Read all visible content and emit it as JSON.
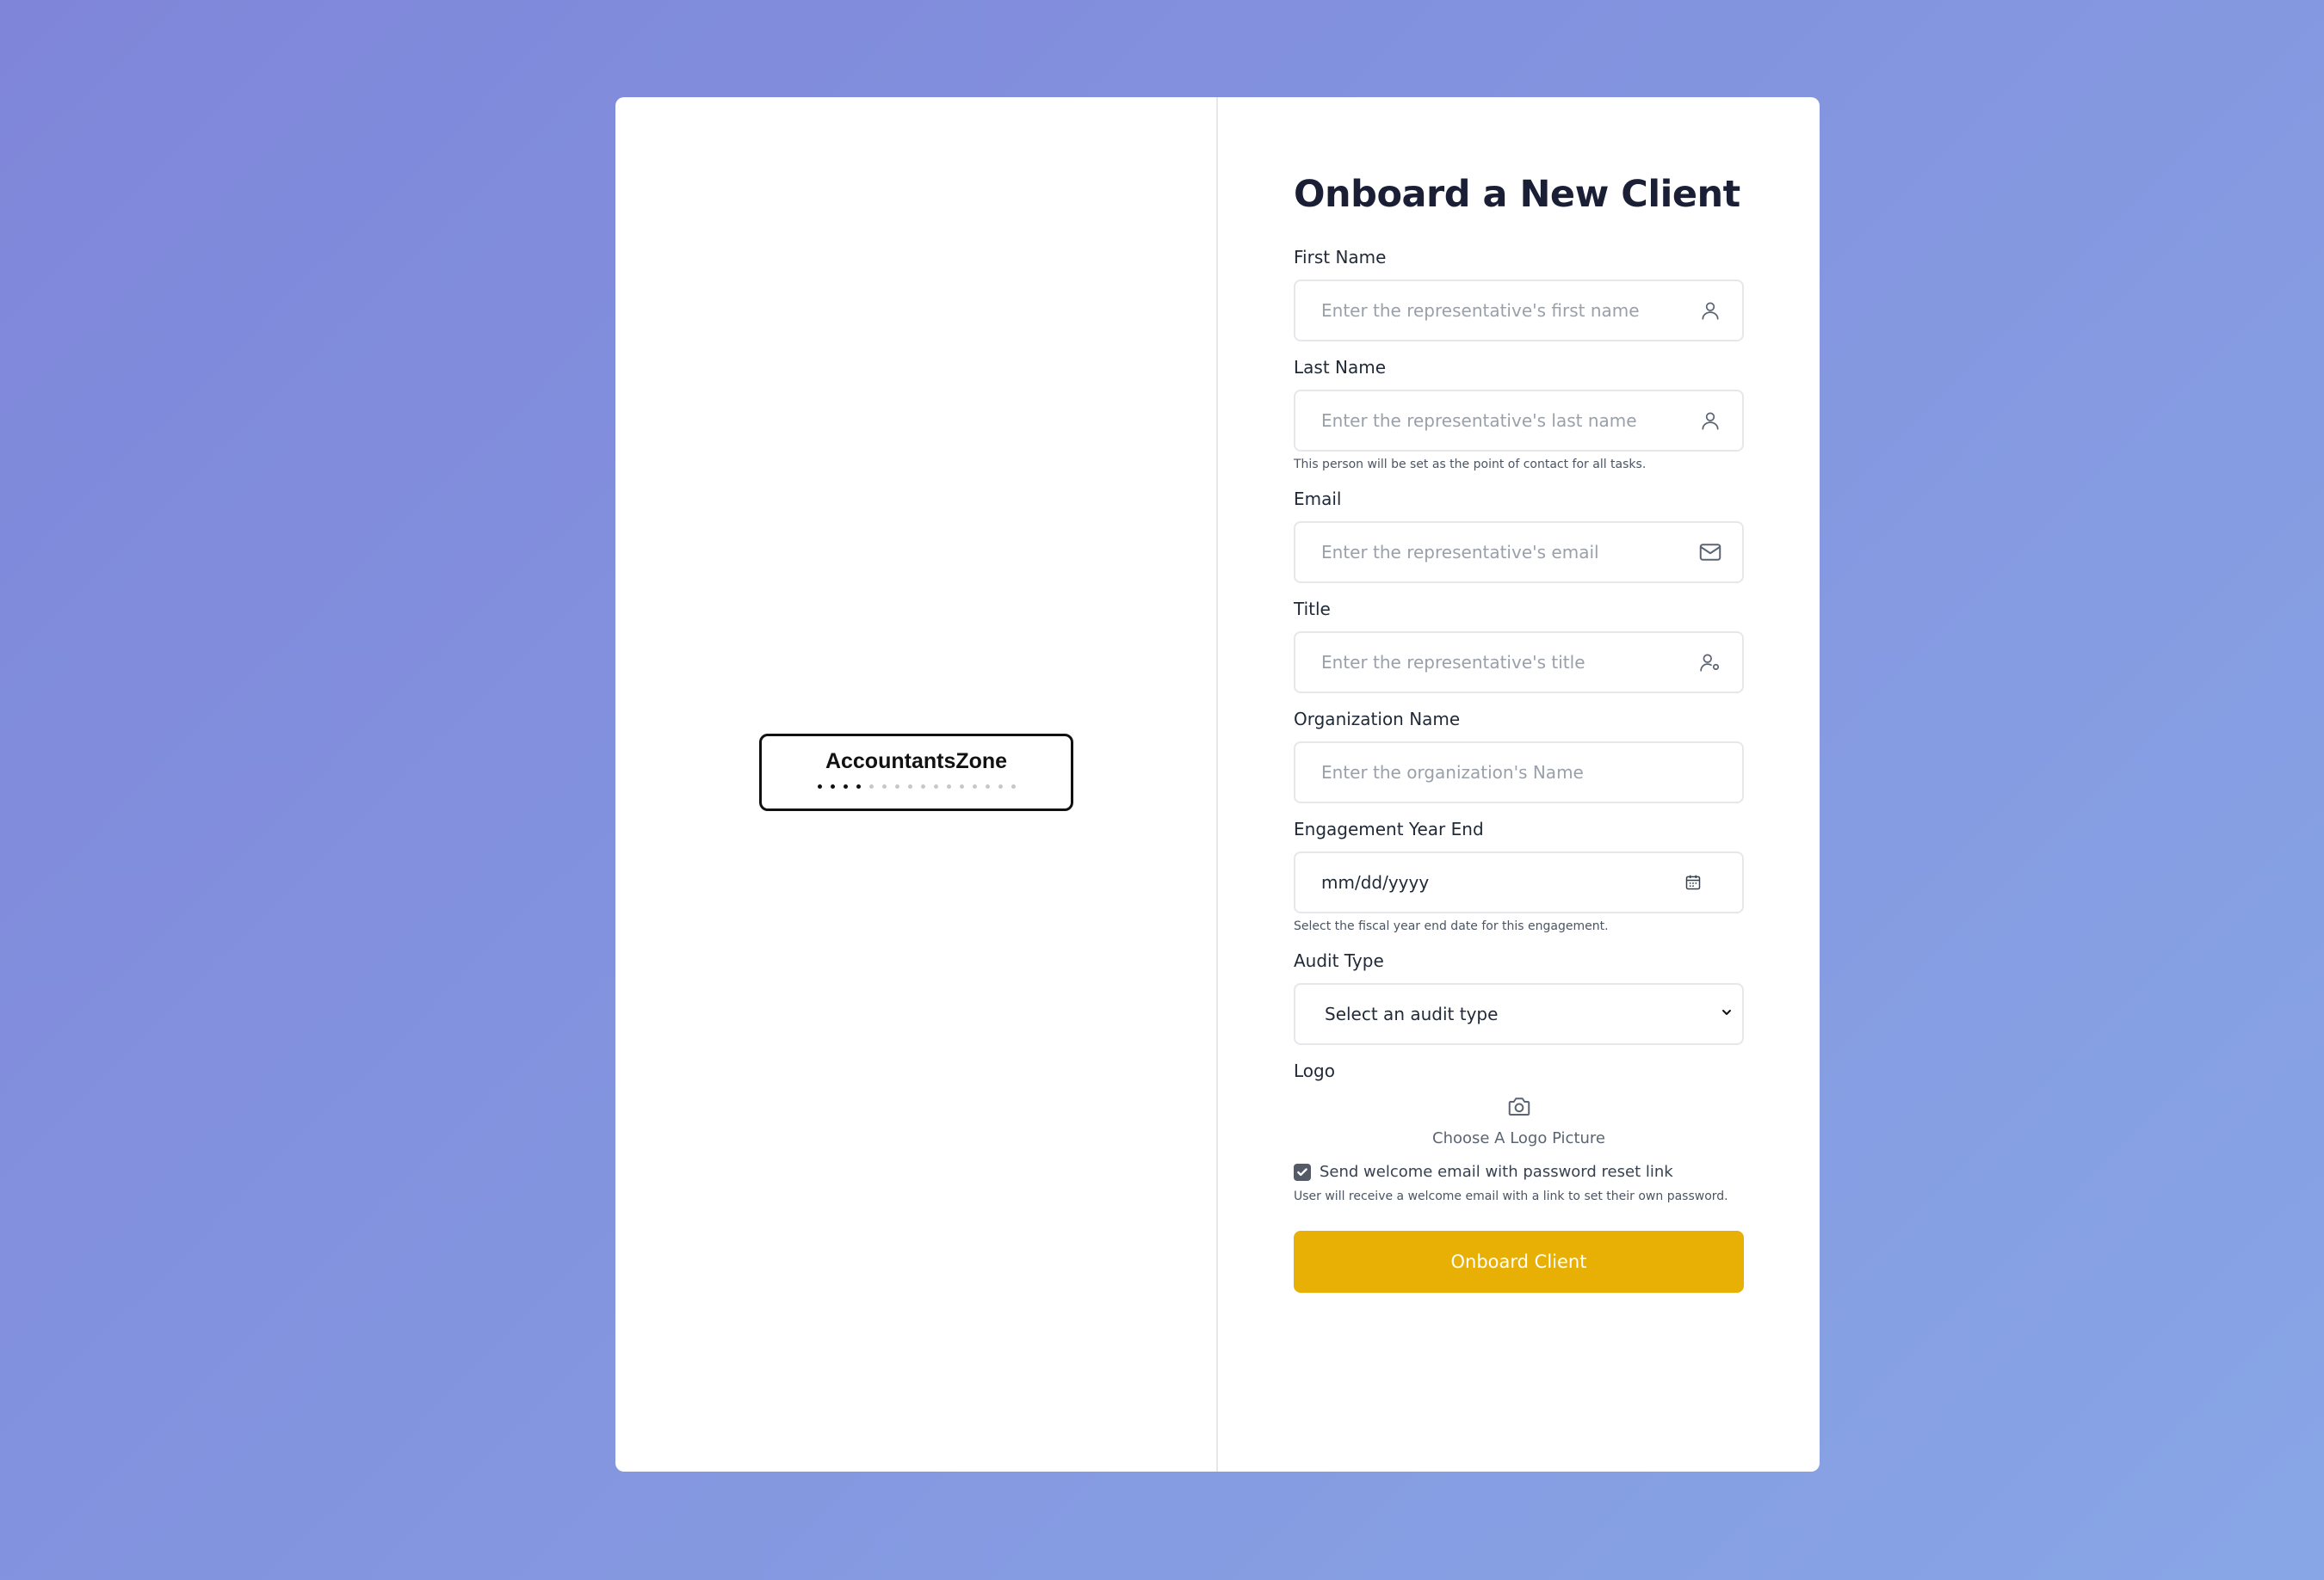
{
  "brand": {
    "name": "AccountantsZone",
    "loader_dots_total": 16,
    "loader_dots_active": 4
  },
  "form": {
    "title": "Onboard a New Client",
    "first_name": {
      "label": "First Name",
      "placeholder": "Enter the representative's first name",
      "icon": "user-icon"
    },
    "last_name": {
      "label": "Last Name",
      "placeholder": "Enter the representative's last name",
      "icon": "user-icon",
      "hint": "This person will be set as the point of contact for all tasks."
    },
    "email": {
      "label": "Email",
      "placeholder": "Enter the representative's email",
      "icon": "mail-icon"
    },
    "title_field": {
      "label": "Title",
      "placeholder": "Enter the representative's title",
      "icon": "user-settings-icon"
    },
    "organization": {
      "label": "Organization Name",
      "placeholder": "Enter the organization's Name"
    },
    "engagement_year_end": {
      "label": "Engagement Year End",
      "value": "mm/dd/yyyy",
      "icon": "calendar-icon",
      "hint": "Select the fiscal year end date for this engagement."
    },
    "audit_type": {
      "label": "Audit Type",
      "selected": "Select an audit type"
    },
    "logo": {
      "label": "Logo",
      "upload_label": "Choose A Logo Picture",
      "icon": "camera-icon"
    },
    "welcome_email": {
      "checked": true,
      "label": "Send welcome email with password reset link",
      "hint": "User will receive a welcome email with a link to set their own password."
    },
    "submit_label": "Onboard Client"
  },
  "colors": {
    "accent": "#e8b005",
    "background_start": "#7f86da",
    "background_end": "#88a6e6"
  }
}
